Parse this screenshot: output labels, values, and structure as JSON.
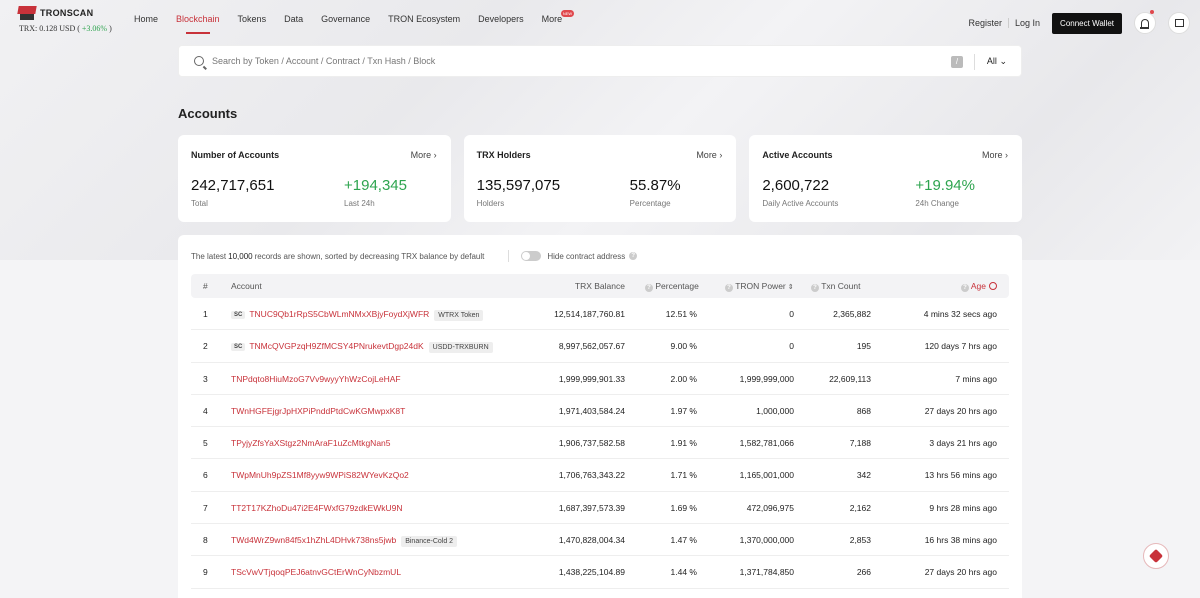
{
  "header": {
    "logo_text": "TRONSCAN",
    "price_label": "TRX: 0.128 USD (",
    "price_change": "+3.06%",
    "price_close": ")",
    "nav": [
      "Home",
      "Blockchain",
      "Tokens",
      "Data",
      "Governance",
      "TRON Ecosystem",
      "Developers",
      "More"
    ],
    "active_nav": "Blockchain",
    "new_badge": "NEW",
    "register": "Register",
    "login": "Log In",
    "connect_wallet": "Connect Wallet"
  },
  "search": {
    "placeholder": "Search by Token / Account / Contract / Txn Hash / Block",
    "shortcut": "/",
    "filter": "All"
  },
  "page_title": "Accounts",
  "cards": [
    {
      "title": "Number of Accounts",
      "more": "More",
      "v1": "242,717,651",
      "l1": "Total",
      "v2": "+194,345",
      "l2": "Last 24h"
    },
    {
      "title": "TRX Holders",
      "more": "More",
      "v1": "135,597,075",
      "l1": "Holders",
      "v2": "55.87%",
      "l2": "Percentage"
    },
    {
      "title": "Active Accounts",
      "more": "More",
      "v1": "2,600,722",
      "l1": "Daily Active Accounts",
      "v2": "+19.94%",
      "l2": "24h Change"
    }
  ],
  "table": {
    "note_pre": "The latest",
    "note_count": "10,000",
    "note_post": "records are shown, sorted by decreasing TRX balance by default",
    "toggle_label": "Hide contract address",
    "headers": {
      "num": "#",
      "account": "Account",
      "balance": "TRX Balance",
      "percentage": "Percentage",
      "power": "TRON Power",
      "txn": "Txn Count",
      "age": "Age"
    },
    "sc_label": "SC",
    "rows": [
      {
        "num": "1",
        "account": "TNUC9Qb1rRpS5CbWLmNMxXBjyFoydXjWFR",
        "sc": true,
        "tag": "WTRX Token",
        "balance": "12,514,187,760.81",
        "percentage": "12.51 %",
        "power": "0",
        "txn": "2,365,882",
        "age": "4 mins 32 secs ago"
      },
      {
        "num": "2",
        "account": "TNMcQVGPzqH9ZfMCSY4PNrukevtDgp24dK",
        "sc": true,
        "tag": "USDD-TRXBURN",
        "balance": "8,997,562,057.67",
        "percentage": "9.00 %",
        "power": "0",
        "txn": "195",
        "age": "120 days 7 hrs ago"
      },
      {
        "num": "3",
        "account": "TNPdqto8HiuMzoG7Vv9wyyYhWzCojLeHAF",
        "sc": false,
        "tag": "",
        "balance": "1,999,999,901.33",
        "percentage": "2.00 %",
        "power": "1,999,999,000",
        "txn": "22,609,113",
        "age": "7 mins ago"
      },
      {
        "num": "4",
        "account": "TWnHGFEjgrJpHXPiPnddPtdCwKGMwpxK8T",
        "sc": false,
        "tag": "",
        "balance": "1,971,403,584.24",
        "percentage": "1.97 %",
        "power": "1,000,000",
        "txn": "868",
        "age": "27 days 20 hrs ago"
      },
      {
        "num": "5",
        "account": "TPyjyZfsYaXStgz2NmAraF1uZcMtkgNan5",
        "sc": false,
        "tag": "",
        "balance": "1,906,737,582.58",
        "percentage": "1.91 %",
        "power": "1,582,781,066",
        "txn": "7,188",
        "age": "3 days 21 hrs ago"
      },
      {
        "num": "6",
        "account": "TWpMnUh9pZS1Mf8yyw9WPiS82WYevKzQo2",
        "sc": false,
        "tag": "",
        "balance": "1,706,763,343.22",
        "percentage": "1.71 %",
        "power": "1,165,001,000",
        "txn": "342",
        "age": "13 hrs 56 mins ago"
      },
      {
        "num": "7",
        "account": "TT2T17KZhoDu47i2E4FWxfG79zdkEWkU9N",
        "sc": false,
        "tag": "",
        "balance": "1,687,397,573.39",
        "percentage": "1.69 %",
        "power": "472,096,975",
        "txn": "2,162",
        "age": "9 hrs 28 mins ago"
      },
      {
        "num": "8",
        "account": "TWd4WrZ9wn84f5x1hZhL4DHvk738ns5jwb",
        "sc": false,
        "tag": "Binance-Cold 2",
        "balance": "1,470,828,004.34",
        "percentage": "1.47 %",
        "power": "1,370,000,000",
        "txn": "2,853",
        "age": "16 hrs 38 mins ago"
      },
      {
        "num": "9",
        "account": "TScVwVTjqoqPEJ6atnvGCtErWnCyNbzmUL",
        "sc": false,
        "tag": "",
        "balance": "1,438,225,104.89",
        "percentage": "1.44 %",
        "power": "1,371,784,850",
        "txn": "266",
        "age": "27 days 20 hrs ago"
      }
    ]
  },
  "icons": {
    "search": "search-icon",
    "bell": "bell-icon",
    "wallet_box": "box-icon",
    "help": "question-icon",
    "age_clock": "clock-icon",
    "support": "support-icon"
  },
  "colors": {
    "accent": "#c8323a",
    "positive": "#2ea44f"
  }
}
